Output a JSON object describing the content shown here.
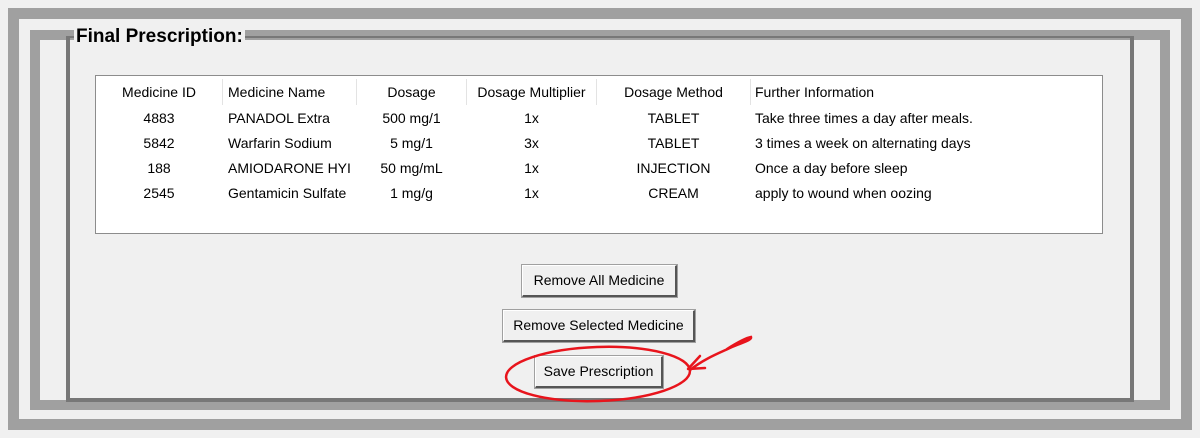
{
  "group_title": "Final Prescription:",
  "table": {
    "columns": [
      "Medicine ID",
      "Medicine Name",
      "Dosage",
      "Dosage Multiplier",
      "Dosage Method",
      "Further Information"
    ],
    "rows": [
      [
        "4883",
        "PANADOL Extra",
        "500 mg/1",
        "1x",
        "TABLET",
        "Take  three times a day after meals."
      ],
      [
        "5842",
        "Warfarin Sodium",
        "5 mg/1",
        "3x",
        "TABLET",
        "3 times a week on alternating days"
      ],
      [
        "188",
        "AMIODARONE HYI",
        "50 mg/mL",
        "1x",
        "INJECTION",
        "Once a day before sleep"
      ],
      [
        "2545",
        "Gentamicin Sulfate",
        "1 mg/g",
        "1x",
        "CREAM",
        "apply to wound when oozing"
      ]
    ]
  },
  "buttons": {
    "remove_all": "Remove All Medicine",
    "remove_selected": "Remove Selected Medicine",
    "save": "Save Prescription"
  },
  "annotation": {
    "color": "#e8141c"
  }
}
